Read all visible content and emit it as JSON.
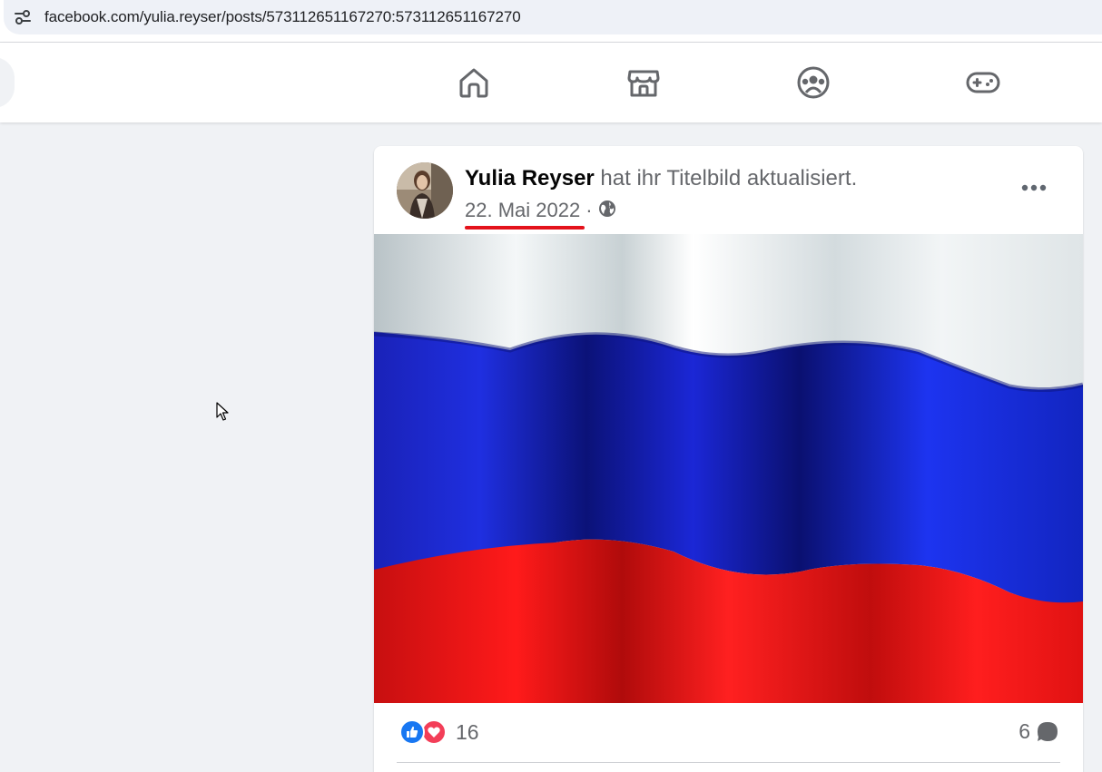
{
  "browser": {
    "url": "facebook.com/yulia.reyser/posts/573112651167270:573112651167270",
    "site_info_icon": "tune-icon"
  },
  "nav": {
    "tabs": [
      {
        "name": "home",
        "icon": "home-icon"
      },
      {
        "name": "marketplace",
        "icon": "marketplace-icon"
      },
      {
        "name": "groups",
        "icon": "groups-icon"
      },
      {
        "name": "gaming",
        "icon": "gaming-icon"
      }
    ]
  },
  "post": {
    "author": "Yulia Reyser",
    "action": " hat ihr Titelbild aktualisiert.",
    "date": "22. Mai 2022",
    "separator": "·",
    "audience_icon": "globe-icon",
    "more_icon": "more-options-icon",
    "image_description_icon": "russian-flag-image",
    "reaction_count": "16",
    "reaction_types": [
      "like",
      "love"
    ],
    "comment_count": "6"
  },
  "colors": {
    "facebook_blue": "#1877f2",
    "love_red": "#f33e58",
    "highlight_underline": "#e4121b",
    "flag_white": "#ffffff",
    "flag_blue": "#0039a6",
    "flag_red": "#d52b1e"
  }
}
